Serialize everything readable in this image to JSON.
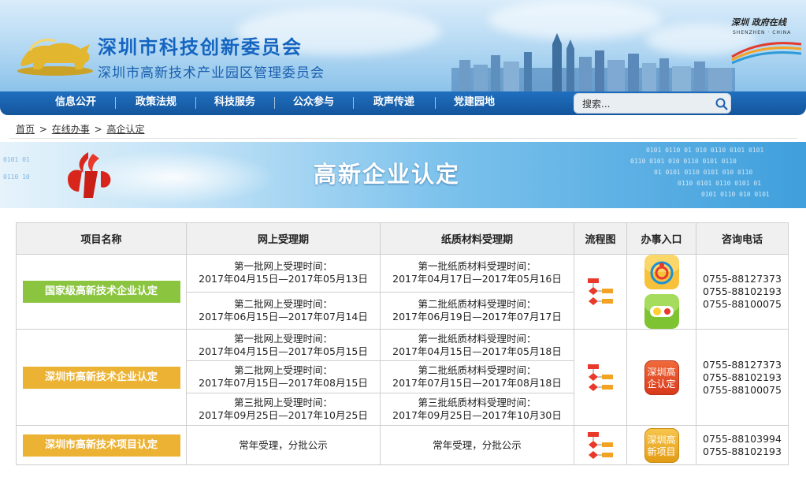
{
  "header": {
    "title": "深圳市科技创新委员会",
    "subtitle": "深圳市高新技术产业园区管理委员会",
    "city_logo_cn": "深圳 政府在线",
    "city_logo_en": "SHENZHEN · CHINA"
  },
  "nav": {
    "items": [
      {
        "label": "信息公开"
      },
      {
        "label": "政策法规"
      },
      {
        "label": "科技服务"
      },
      {
        "label": "公众参与"
      },
      {
        "label": "政声传递"
      },
      {
        "label": "党建园地"
      }
    ],
    "search_placeholder": "搜索..."
  },
  "breadcrumb": {
    "home": "首页",
    "sep": ">",
    "level2": "在线办事",
    "current": "高企认定"
  },
  "section": {
    "title": "高新企业认定"
  },
  "table": {
    "headers": {
      "name": "项目名称",
      "online": "网上受理期",
      "paper": "纸质材料受理期",
      "flow": "流程图",
      "entry": "办事入口",
      "phone": "咨询电话"
    },
    "rows": [
      {
        "name": "国家级高新技术企业认定",
        "batches": [
          {
            "online_label": "第一批网上受理时间：",
            "online_dates": "2017年04月15日—2017年05月13日",
            "paper_label": "第一批纸质材料受理时间：",
            "paper_dates": "2017年04月17日—2017年05月16日"
          },
          {
            "online_label": "第二批网上受理时间：",
            "online_dates": "2017年06月15日—2017年07月14日",
            "paper_label": "第二批纸质材料受理时间：",
            "paper_dates": "2017年06月19日—2017年07月17日"
          }
        ],
        "phones": [
          "0755-88127373",
          "0755-88102193",
          "0755-88100075"
        ]
      },
      {
        "name": "深圳市高新技术企业认定",
        "batches": [
          {
            "online_label": "第一批网上受理时间：",
            "online_dates": "2017年04月15日—2017年05月15日",
            "paper_label": "第一批纸质材料受理时间：",
            "paper_dates": "2017年04月15日—2017年05月18日"
          },
          {
            "online_label": "第二批网上受理时间：",
            "online_dates": "2017年07月15日—2017年08月15日",
            "paper_label": "第二批纸质材料受理时间：",
            "paper_dates": "2017年07月15日—2017年08月18日"
          },
          {
            "online_label": "第三批网上受理时间：",
            "online_dates": "2017年09月25日—2017年10月25日",
            "paper_label": "第三批纸质材料受理时间：",
            "paper_dates": "2017年09月25日—2017年10月30日"
          }
        ],
        "entry_label": "深圳高企认定",
        "phones": [
          "0755-88127373",
          "0755-88102193",
          "0755-88100075"
        ]
      },
      {
        "name": "深圳市高新技术项目认定",
        "online": "常年受理，分批公示",
        "paper": "常年受理，分批公示",
        "entry_label": "深圳高新项目",
        "phones": [
          "0755-88103994",
          "0755-88102193"
        ]
      }
    ]
  },
  "colors": {
    "nav_bg": "#1a62ad",
    "title_blue": "#1565c0",
    "btn_green": "#8bc53f",
    "btn_orange": "#ecb233",
    "entry_red": "#e04a24"
  }
}
